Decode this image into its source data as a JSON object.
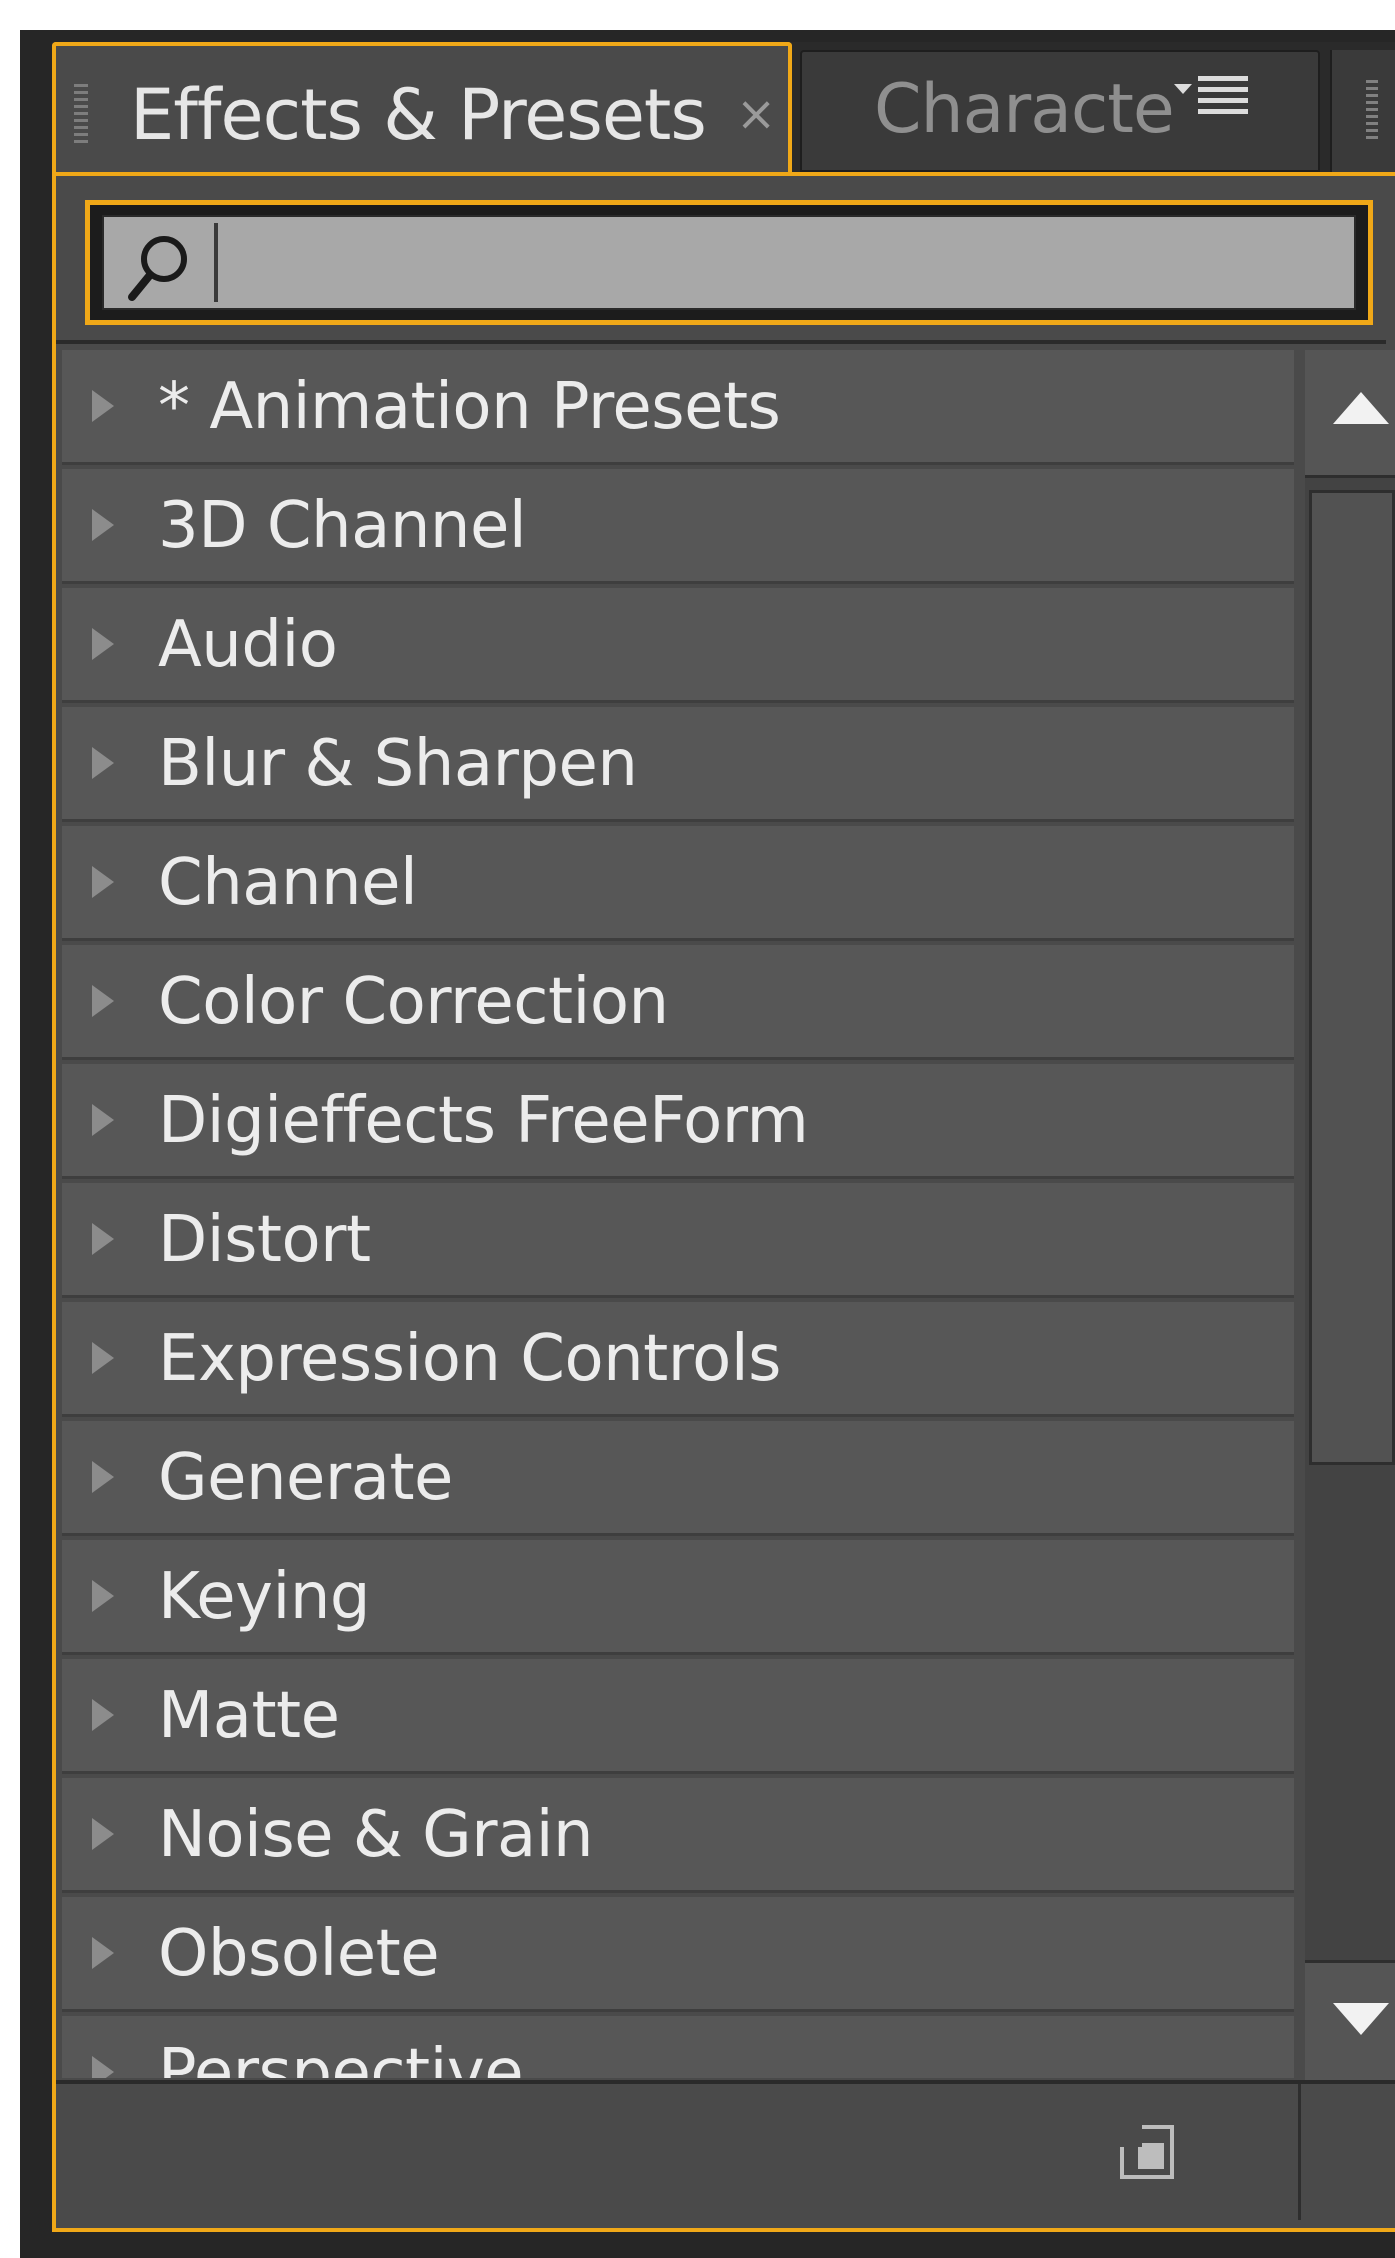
{
  "panel": {
    "active_tab": {
      "label": "Effects & Presets",
      "close": "×"
    },
    "inactive_tab": {
      "label": "Characte"
    },
    "search": {
      "value": "",
      "placeholder": ""
    },
    "items": [
      {
        "label": "* Animation Presets"
      },
      {
        "label": "3D Channel"
      },
      {
        "label": "Audio"
      },
      {
        "label": "Blur & Sharpen"
      },
      {
        "label": "Channel"
      },
      {
        "label": "Color Correction"
      },
      {
        "label": "Digieffects FreeForm"
      },
      {
        "label": "Distort"
      },
      {
        "label": "Expression Controls"
      },
      {
        "label": "Generate"
      },
      {
        "label": "Keying"
      },
      {
        "label": "Matte"
      },
      {
        "label": "Noise & Grain"
      },
      {
        "label": "Obsolete"
      },
      {
        "label": "Perspective"
      }
    ]
  },
  "icons": {
    "search": "search-icon",
    "expand": "expand-triangle-icon",
    "panel_menu": "panel-menu-icon",
    "new_item": "new-item-icon"
  },
  "colors": {
    "focus": "#f0a818",
    "panel_bg": "#4a4a4a",
    "item_bg": "#575757",
    "text": "#ececec"
  }
}
